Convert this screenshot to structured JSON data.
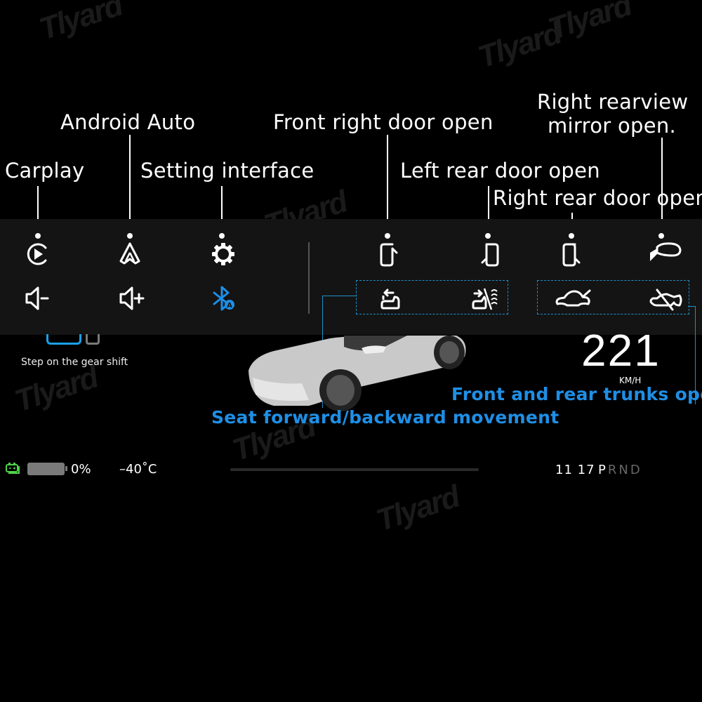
{
  "watermark": "Tlyard",
  "callouts": {
    "carplay": "Carplay",
    "android_auto": "Android Auto",
    "setting_interface": "Setting interface",
    "front_right_door": "Front right door open",
    "left_rear_door": "Left rear door open",
    "right_rear_door": "Right rear door open",
    "right_mirror_line1": "Right rearview",
    "right_mirror_line2": "mirror open.",
    "seat_movement": "Seat forward/backward movement",
    "trunks_open": "Front and rear trunks open"
  },
  "controls": {
    "left_row1": [
      {
        "name": "carplay-icon",
        "label": "Carplay"
      },
      {
        "name": "android-auto-icon",
        "label": "Android Auto"
      },
      {
        "name": "settings-gear-icon",
        "label": "Settings"
      }
    ],
    "left_row2": [
      {
        "name": "volume-down-icon",
        "label": "Volume down"
      },
      {
        "name": "volume-up-icon",
        "label": "Volume up"
      },
      {
        "name": "bluetooth-auto-icon",
        "label": "Bluetooth auto"
      }
    ],
    "right_row1": [
      {
        "name": "front-right-door-icon"
      },
      {
        "name": "left-rear-door-icon"
      },
      {
        "name": "right-rear-door-icon"
      },
      {
        "name": "right-mirror-icon"
      }
    ],
    "right_row2": [
      {
        "name": "seat-backward-icon"
      },
      {
        "name": "seat-forward-icon"
      },
      {
        "name": "front-trunk-open-icon"
      },
      {
        "name": "rear-trunk-open-icon"
      }
    ],
    "accent_color": "#1e8fe6"
  },
  "dashboard": {
    "gear_hint": "Step on the gear shift",
    "speed": "221",
    "speed_unit": "KM/H",
    "battery_percent": "0%",
    "battery_level": 0,
    "temperature": "–40˚C",
    "time": "11 17",
    "gears": [
      "P",
      "R",
      "N",
      "D"
    ],
    "active_gear": "P",
    "battery_color": "#4fd14a"
  }
}
